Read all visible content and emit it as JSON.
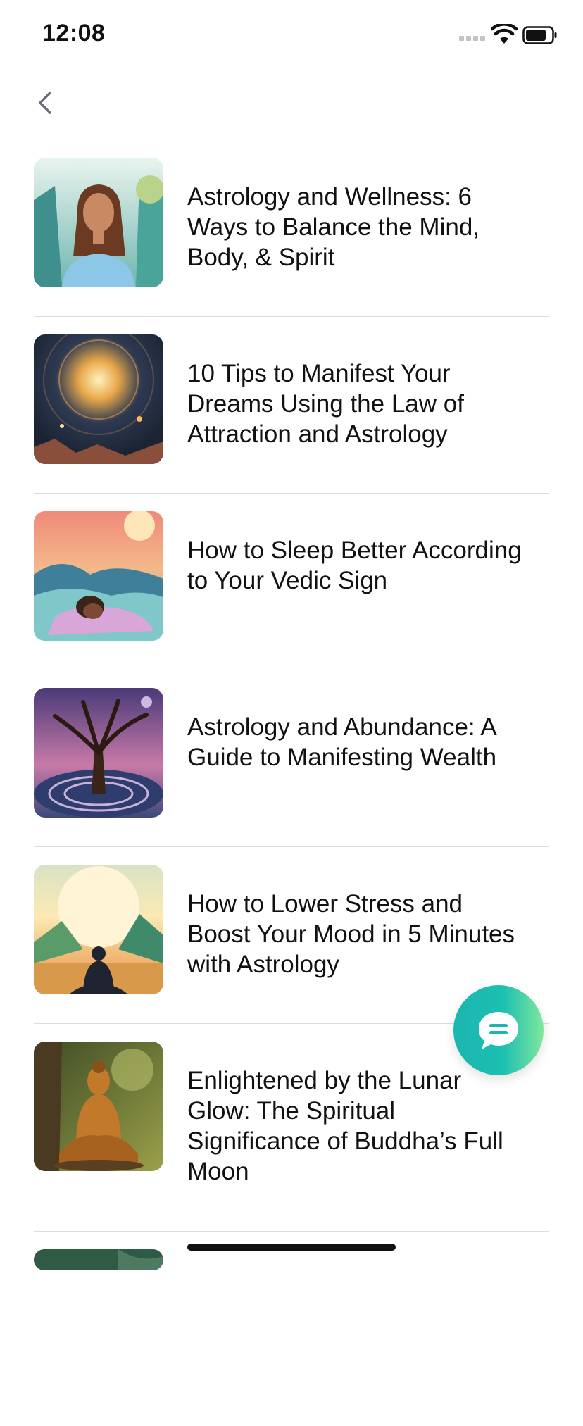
{
  "status_bar": {
    "time": "12:08"
  },
  "nav": {
    "back_icon": "chevron-left-icon"
  },
  "articles": [
    {
      "title": "Astrology and Wellness: 6 Ways to Balance the Mind, Body, & Spirit",
      "image": "woman-meditating"
    },
    {
      "title": "10 Tips to Manifest Your Dreams Using the Law of Attraction and Astrology",
      "image": "glowing-cosmic-orb"
    },
    {
      "title": "How to Sleep Better According to Your Vedic Sign",
      "image": "woman-sleeping-in-clouds"
    },
    {
      "title": "Astrology and Abundance: A Guide to Manifesting Wealth",
      "image": "tree-on-labyrinth"
    },
    {
      "title": "How to Lower Stress and Boost Your Mood in 5 Minutes with Astrology",
      "image": "meditating-silhouette-at-sunset"
    },
    {
      "title": "Enlightened by the Lunar Glow: The Spiritual Significance of Buddha’s Full Moon",
      "image": "buddha-statue"
    }
  ],
  "chat_fab": {
    "icon": "chat-bubble-icon"
  },
  "colors": {
    "fab_start": "#1cb6b0",
    "fab_end": "#7fe79c",
    "divider": "#dcdcdc"
  }
}
